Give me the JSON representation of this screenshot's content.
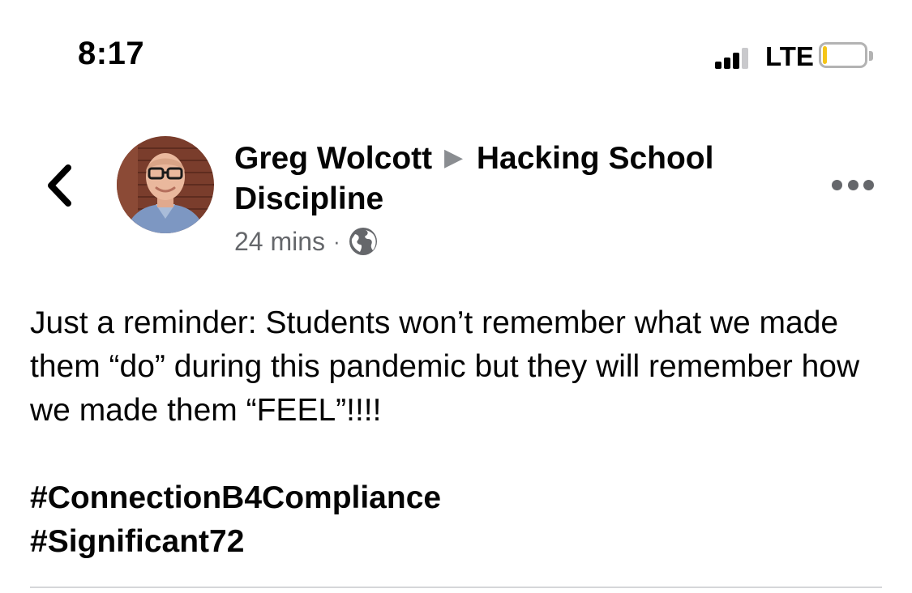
{
  "status_bar": {
    "time": "8:17",
    "network": "LTE",
    "signal_bars_filled": 3,
    "signal_bars_total": 4,
    "battery_level": 0.1,
    "battery_color": "#f5c518"
  },
  "post": {
    "author": "Greg Wolcott",
    "separator_icon": "triangle-right-icon",
    "group": "Hacking School Discipline",
    "timestamp": "24 mins",
    "meta_separator": "·",
    "privacy_icon": "globe-icon",
    "text": "Just a reminder: Students won’t remember what we made them “do” during this pandemic but they will remember how we made them “FEEL”!!!!",
    "hashtags": [
      "#ConnectionB4Compliance",
      "#Significant72"
    ]
  },
  "icons": {
    "back": "chevron-left-icon",
    "more": "more-options-icon"
  }
}
